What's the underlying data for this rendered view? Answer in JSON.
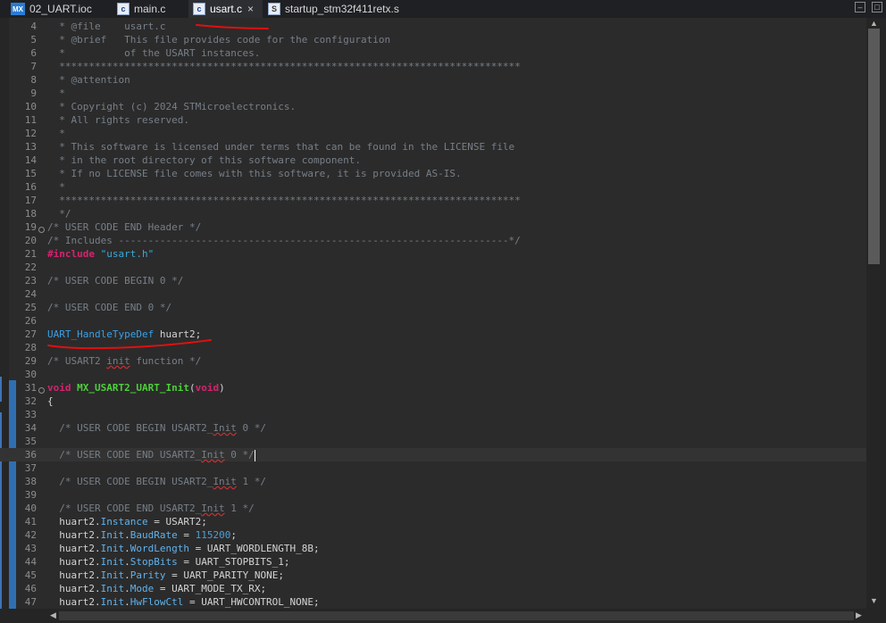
{
  "tabs": [
    {
      "label": "02_UART.ioc",
      "icon": "mx-icon",
      "icon_text": "MX",
      "active": false
    },
    {
      "label": "main.c",
      "icon": "c-file-icon",
      "icon_text": "c",
      "active": false
    },
    {
      "label": "usart.c",
      "icon": "c-file-icon",
      "icon_text": "c",
      "active": true,
      "close": "×"
    },
    {
      "label": "startup_stm32f411retx.s",
      "icon": "asm-file-icon",
      "icon_text": "S",
      "active": false
    }
  ],
  "window_controls": {
    "minimize": "–",
    "maximize": "□"
  },
  "editor": {
    "file": "usart.c",
    "lines": [
      {
        "n": "4",
        "segs": [
          [
            "cm",
            "  * @file    usart.c"
          ]
        ]
      },
      {
        "n": "5",
        "segs": [
          [
            "cm",
            "  * @brief   This file provides code for the configuration"
          ]
        ]
      },
      {
        "n": "6",
        "segs": [
          [
            "cm",
            "  *          of the USART instances."
          ]
        ]
      },
      {
        "n": "7",
        "segs": [
          [
            "cm",
            "  ******************************************************************************"
          ]
        ]
      },
      {
        "n": "8",
        "segs": [
          [
            "cm",
            "  * @attention"
          ]
        ]
      },
      {
        "n": "9",
        "segs": [
          [
            "cm",
            "  *"
          ]
        ]
      },
      {
        "n": "10",
        "segs": [
          [
            "cm",
            "  * Copyright (c) 2024 STMicroelectronics."
          ]
        ]
      },
      {
        "n": "11",
        "segs": [
          [
            "cm",
            "  * All rights reserved."
          ]
        ]
      },
      {
        "n": "12",
        "segs": [
          [
            "cm",
            "  *"
          ]
        ]
      },
      {
        "n": "13",
        "segs": [
          [
            "cm",
            "  * This software is licensed under terms that can be found in the LICENSE file"
          ]
        ]
      },
      {
        "n": "14",
        "segs": [
          [
            "cm",
            "  * in the root directory of this software component."
          ]
        ]
      },
      {
        "n": "15",
        "segs": [
          [
            "cm",
            "  * If no LICENSE file comes with this software, it is provided AS-IS."
          ]
        ]
      },
      {
        "n": "16",
        "segs": [
          [
            "cm",
            "  *"
          ]
        ]
      },
      {
        "n": "17",
        "segs": [
          [
            "cm",
            "  ******************************************************************************"
          ]
        ]
      },
      {
        "n": "18",
        "segs": [
          [
            "cm",
            "  */"
          ]
        ]
      },
      {
        "n": "19",
        "segs": [
          [
            "cm",
            "/* USER CODE END Header */"
          ]
        ]
      },
      {
        "n": "20",
        "segs": [
          [
            "cm",
            "/* Includes ------------------------------------------------------------------*/"
          ]
        ]
      },
      {
        "n": "21",
        "segs": [
          [
            "kw",
            "#include"
          ],
          [
            "pl",
            " "
          ],
          [
            "str",
            "\"usart.h\""
          ]
        ]
      },
      {
        "n": "22",
        "segs": []
      },
      {
        "n": "23",
        "segs": [
          [
            "cm",
            "/* USER CODE BEGIN 0 */"
          ]
        ]
      },
      {
        "n": "24",
        "segs": []
      },
      {
        "n": "25",
        "segs": [
          [
            "cm",
            "/* USER CODE END 0 */"
          ]
        ]
      },
      {
        "n": "26",
        "segs": []
      },
      {
        "n": "27",
        "segs": [
          [
            "ty",
            "UART_HandleTypeDef"
          ],
          [
            "pl",
            " huart2;"
          ]
        ]
      },
      {
        "n": "28",
        "segs": []
      },
      {
        "n": "29",
        "segs": [
          [
            "cm",
            "/* USART2 "
          ],
          [
            "cmsq",
            "init"
          ],
          [
            "cm",
            " function */"
          ]
        ]
      },
      {
        "n": "30",
        "segs": []
      },
      {
        "n": "31",
        "segs": [
          [
            "kw",
            "void"
          ],
          [
            "pl",
            " "
          ],
          [
            "fn",
            "MX_USART2_UART_Init"
          ],
          [
            "pl",
            "("
          ],
          [
            "kw",
            "void"
          ],
          [
            "pl",
            ")"
          ]
        ]
      },
      {
        "n": "32",
        "segs": [
          [
            "pl",
            "{"
          ]
        ]
      },
      {
        "n": "33",
        "segs": []
      },
      {
        "n": "34",
        "segs": [
          [
            "cm",
            "  /* USER CODE BEGIN USART2_"
          ],
          [
            "cmsq",
            "Init"
          ],
          [
            "cm",
            " 0 */"
          ]
        ]
      },
      {
        "n": "35",
        "segs": []
      },
      {
        "n": "36",
        "segs": [
          [
            "cm",
            "  /* USER CODE END USART2_"
          ],
          [
            "cmsq",
            "Init"
          ],
          [
            "cm",
            " 0 */"
          ],
          [
            "caret",
            ""
          ]
        ],
        "current": true
      },
      {
        "n": "37",
        "segs": []
      },
      {
        "n": "38",
        "segs": [
          [
            "cm",
            "  /* USER CODE BEGIN USART2_"
          ],
          [
            "cmsq",
            "Init"
          ],
          [
            "cm",
            " 1 */"
          ]
        ]
      },
      {
        "n": "39",
        "segs": []
      },
      {
        "n": "40",
        "segs": [
          [
            "cm",
            "  /* USER CODE END USART2_"
          ],
          [
            "cmsq",
            "Init"
          ],
          [
            "cm",
            " 1 */"
          ]
        ]
      },
      {
        "n": "41",
        "segs": [
          [
            "pl",
            "  huart2."
          ],
          [
            "fld",
            "Instance"
          ],
          [
            "pl",
            " = USART2;"
          ]
        ]
      },
      {
        "n": "42",
        "segs": [
          [
            "pl",
            "  huart2."
          ],
          [
            "fld",
            "Init"
          ],
          [
            "pl",
            "."
          ],
          [
            "fld",
            "BaudRate"
          ],
          [
            "pl",
            " = "
          ],
          [
            "num",
            "115200"
          ],
          [
            "pl",
            ";"
          ]
        ]
      },
      {
        "n": "43",
        "segs": [
          [
            "pl",
            "  huart2."
          ],
          [
            "fld",
            "Init"
          ],
          [
            "pl",
            "."
          ],
          [
            "fld",
            "WordLength"
          ],
          [
            "pl",
            " = UART_WORDLENGTH_8B;"
          ]
        ]
      },
      {
        "n": "44",
        "segs": [
          [
            "pl",
            "  huart2."
          ],
          [
            "fld",
            "Init"
          ],
          [
            "pl",
            "."
          ],
          [
            "fld",
            "StopBits"
          ],
          [
            "pl",
            " = UART_STOPBITS_1;"
          ]
        ]
      },
      {
        "n": "45",
        "segs": [
          [
            "pl",
            "  huart2."
          ],
          [
            "fld",
            "Init"
          ],
          [
            "pl",
            "."
          ],
          [
            "fld",
            "Parity"
          ],
          [
            "pl",
            " = UART_PARITY_NONE;"
          ]
        ]
      },
      {
        "n": "46",
        "segs": [
          [
            "pl",
            "  huart2."
          ],
          [
            "fld",
            "Init"
          ],
          [
            "pl",
            "."
          ],
          [
            "fld",
            "Mode"
          ],
          [
            "pl",
            " = UART_MODE_TX_RX;"
          ]
        ]
      },
      {
        "n": "47",
        "segs": [
          [
            "pl",
            "  huart2."
          ],
          [
            "fld",
            "Init"
          ],
          [
            "pl",
            "."
          ],
          [
            "fld",
            "HwFlowCtl"
          ],
          [
            "pl",
            " = UART_HWCONTROL_NONE;"
          ]
        ]
      }
    ]
  },
  "colors": {
    "background": "#2b2b2b",
    "comment": "#777f88",
    "keyword": "#d6236e",
    "string": "#3ba8d8",
    "type": "#3aa0e6",
    "function": "#4ecf3b",
    "annotation_red": "#e01010"
  },
  "scrollbars": {
    "up": "▲",
    "down": "▼",
    "left": "◀",
    "right": "▶"
  }
}
